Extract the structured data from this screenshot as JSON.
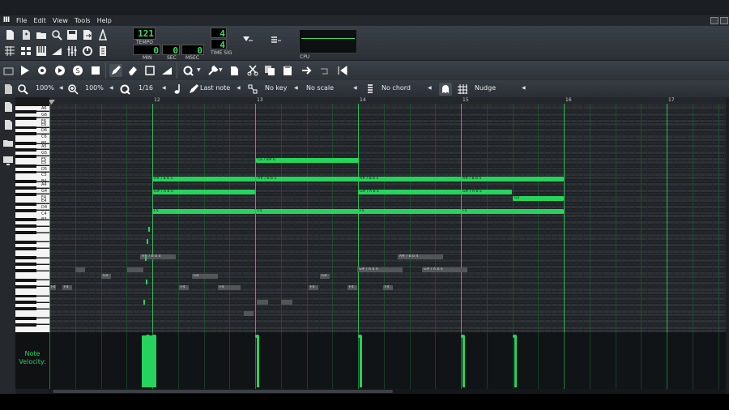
{
  "menu": {
    "items": [
      "File",
      "Edit",
      "View",
      "Tools",
      "Help"
    ]
  },
  "transport": {
    "tempo": "121",
    "tempo_label": "TEMPO",
    "min": "0",
    "sec": "0",
    "msec": "0",
    "min_label": "MIN",
    "sec_label": "SEC",
    "msec_label": "MSEC",
    "timesig_num": "4",
    "timesig_den": "4",
    "timesig_label": "TIME SIG",
    "cpu_label": "CPU"
  },
  "editor": {
    "zoom_x": "100%",
    "zoom_y": "100%",
    "quantize": "1/16",
    "note_length": "Last note",
    "key": "No key",
    "scale": "No scale",
    "chord": "No chord",
    "snap": "Nudge"
  },
  "ruler": {
    "bars": [
      "12",
      "13",
      "14",
      "15",
      "16",
      "17"
    ]
  },
  "piano": {
    "labels": [
      "A6",
      "G6",
      "F6",
      "E6",
      "D6",
      "C6",
      "B5",
      "A5",
      "G5",
      "F5",
      "E5",
      "D5",
      "C5",
      "B4",
      "A4",
      "G4",
      "F4",
      "E4",
      "D4",
      "C4",
      "B3"
    ]
  },
  "notes": [
    {
      "label": "C6 / B# 6"
    },
    {
      "label": "A# / B b 5"
    },
    {
      "label": "A# / B b 5"
    },
    {
      "label": "A# / B b 5"
    },
    {
      "label": "A# / B b 5"
    },
    {
      "label": "G# / A b 5"
    },
    {
      "label": "G# / A b 5"
    },
    {
      "label": "G# / A b 5"
    },
    {
      "label": "G5"
    },
    {
      "label": "F5"
    },
    {
      "label": "F5"
    },
    {
      "label": "F5"
    },
    {
      "label": "F5"
    }
  ],
  "ghost_notes": [
    {
      "label": "A# / B b 4"
    },
    {
      "label": "A# / B b 4"
    },
    {
      "label": "G# / A b 4"
    },
    {
      "label": "G# / A b 4"
    },
    {
      "label": "G4"
    },
    {
      "label": "G4"
    },
    {
      "label": "G4"
    },
    {
      "label": "F4"
    },
    {
      "label": "F4"
    },
    {
      "label": "F4"
    },
    {
      "label": "F4"
    },
    {
      "label": "F4"
    },
    {
      "label": "F4"
    },
    {
      "label": "F4"
    }
  ],
  "velocity": {
    "label": "Note Velocity:"
  },
  "colors": {
    "note": "#26d35c",
    "accent": "#3cdc6a",
    "ghost": "#535659"
  }
}
